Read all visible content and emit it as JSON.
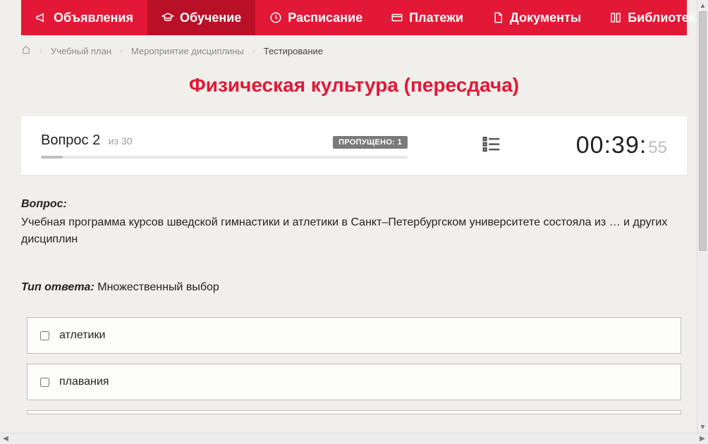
{
  "nav": {
    "items": [
      {
        "label": "Объявления",
        "icon": "megaphone"
      },
      {
        "label": "Обучение",
        "icon": "education",
        "active": true
      },
      {
        "label": "Расписание",
        "icon": "clock"
      },
      {
        "label": "Платежи",
        "icon": "payment"
      },
      {
        "label": "Документы",
        "icon": "document"
      },
      {
        "label": "Библиотека",
        "icon": "library",
        "dropdown": true
      }
    ]
  },
  "breadcrumb": {
    "items": [
      {
        "label": "Учебный план"
      },
      {
        "label": "Мероприятие дисциплины"
      }
    ],
    "current": "Тестирование"
  },
  "page": {
    "title": "Физическая культура (пересдача)"
  },
  "infobar": {
    "question_label": "Вопрос",
    "question_number": "2",
    "total_prefix": "из",
    "question_total": "30",
    "skipped_label": "ПРОПУЩЕНО: 1",
    "timer_main": "00:39:",
    "timer_seconds": "55"
  },
  "question": {
    "label": "Вопрос:",
    "text": "Учебная программа курсов шведской гимнастики и атлетики в Санкт–Петербургском университете состояла из … и других дисциплин",
    "answer_type_label": "Тип ответа:",
    "answer_type_value": "Множественный выбор"
  },
  "answers": [
    {
      "label": "атлетики"
    },
    {
      "label": "плавания"
    }
  ]
}
